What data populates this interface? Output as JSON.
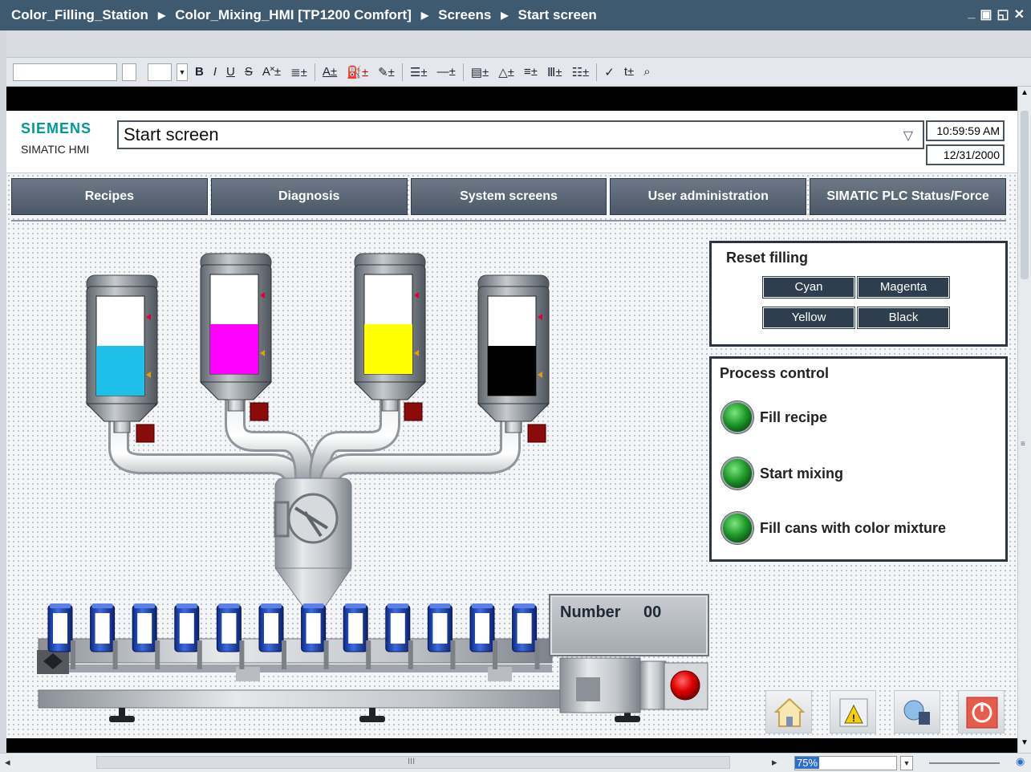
{
  "titlebar": {
    "crumbs": [
      "Color_Filling_Station",
      "Color_Mixing_HMI [TP1200 Comfort]",
      "Screens",
      "Start screen"
    ],
    "window_buttons": [
      "_",
      "▣",
      "◱",
      "✕"
    ]
  },
  "toolbar": {
    "icons": [
      "B",
      "I",
      "U",
      "S",
      "A˟±",
      "≣±",
      "A±",
      "⛽±",
      "✎±",
      "☰±",
      "—±",
      "▤±",
      "△±",
      "≡±",
      "Ⅲ±",
      "☷±",
      "✓",
      "t±",
      "⌕"
    ]
  },
  "hmi": {
    "brand": "SIEMENS",
    "subbrand": "SIMATIC HMI",
    "screen_selector": "Start screen",
    "time": "10:59:59 AM",
    "date": "12/31/2000",
    "nav": [
      "Recipes",
      "Diagnosis",
      "System screens",
      "User administration",
      "SIMATIC PLC Status/Force"
    ],
    "reset_panel": {
      "title": "Reset filling",
      "buttons": [
        "Cyan",
        "Magenta",
        "Yellow",
        "Black"
      ]
    },
    "process_panel": {
      "title": "Process control",
      "items": [
        "Fill recipe",
        "Start mixing",
        "Fill cans with color mixture"
      ]
    },
    "tanks": [
      {
        "name": "cyan",
        "color": "#1ec0ea",
        "level": 0.5
      },
      {
        "name": "magenta",
        "color": "#ff00ff",
        "level": 0.5
      },
      {
        "name": "yellow",
        "color": "#ffff00",
        "level": 0.5
      },
      {
        "name": "black",
        "color": "#000000",
        "level": 0.5
      }
    ],
    "counter": {
      "label": "Number",
      "value": "00"
    },
    "can_count": 12,
    "bottom_icons": [
      "home-icon",
      "alarm-warning-icon",
      "language-globe-icon",
      "power-stop-icon"
    ]
  },
  "statusbar": {
    "zoom": "75%",
    "scroll_mid": "III"
  },
  "colors": {
    "title_bg": "#3e5a70",
    "siemens_teal": "#009999",
    "nav_btn": "#4c5866",
    "led_green": "#1f9a2a"
  }
}
